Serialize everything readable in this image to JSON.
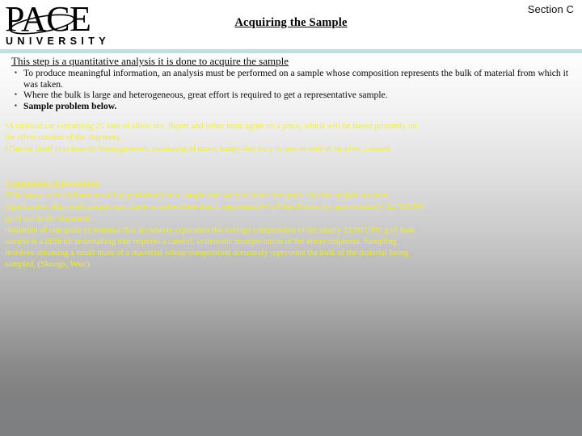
{
  "slide": {
    "section_label": "Section C",
    "title": "Acquiring the Sample",
    "logo": {
      "wordmark": "PACE",
      "subtitle": "UNIVERSITY"
    },
    "colors": {
      "teal_rule": "#bfdfe1",
      "yellow_text": "#f5ef24",
      "body_text": "#0a0a0a",
      "background_top": "#ffffff",
      "background_bottom": "#7e7f80"
    }
  },
  "content": {
    "lead": "This step is a quantitative analysis it is done to acquire the sample",
    "bullets": [
      "To produce meaningful information, an analysis must be performed on a sample whose composition represents the bulk of material from which it was taken.",
      "Where the bulk is large and heterogeneous, great effort is required to get a representative sample.",
      "Sample problem below."
    ],
    "problem_statement": [
      "A railroad car containing 25 tons of silver ore. Buyer and seller must agree on a price, which will be based primarily on the silver content of the shipment.",
      "The car itself is is heavily heterogeneous, consisting of many lumps that vary in size as well as in silver content."
    ],
    "explanation": {
      "heading": "Explanation of procedure",
      "bullets": [
        "The assay of this shipment will be performed on a sample that weighs about one gram. For the analysis to have significance, this small sample must have a composition that is representative of the 25 tons (or approximately 22,700,000 g) of ore in the shipment.",
        "Isolation of one gram of material that accurately represents the average composition of the nearly 23,000,000 g of bulk sample is a difficult undertaking that requires a careful, systematic manipu-lation of the entire shipment. Sampling involves obtaining a small mass of a ma-terial whose composition accurately represents the bulk of the material being sampled. (Skoogs, West)"
      ]
    }
  }
}
